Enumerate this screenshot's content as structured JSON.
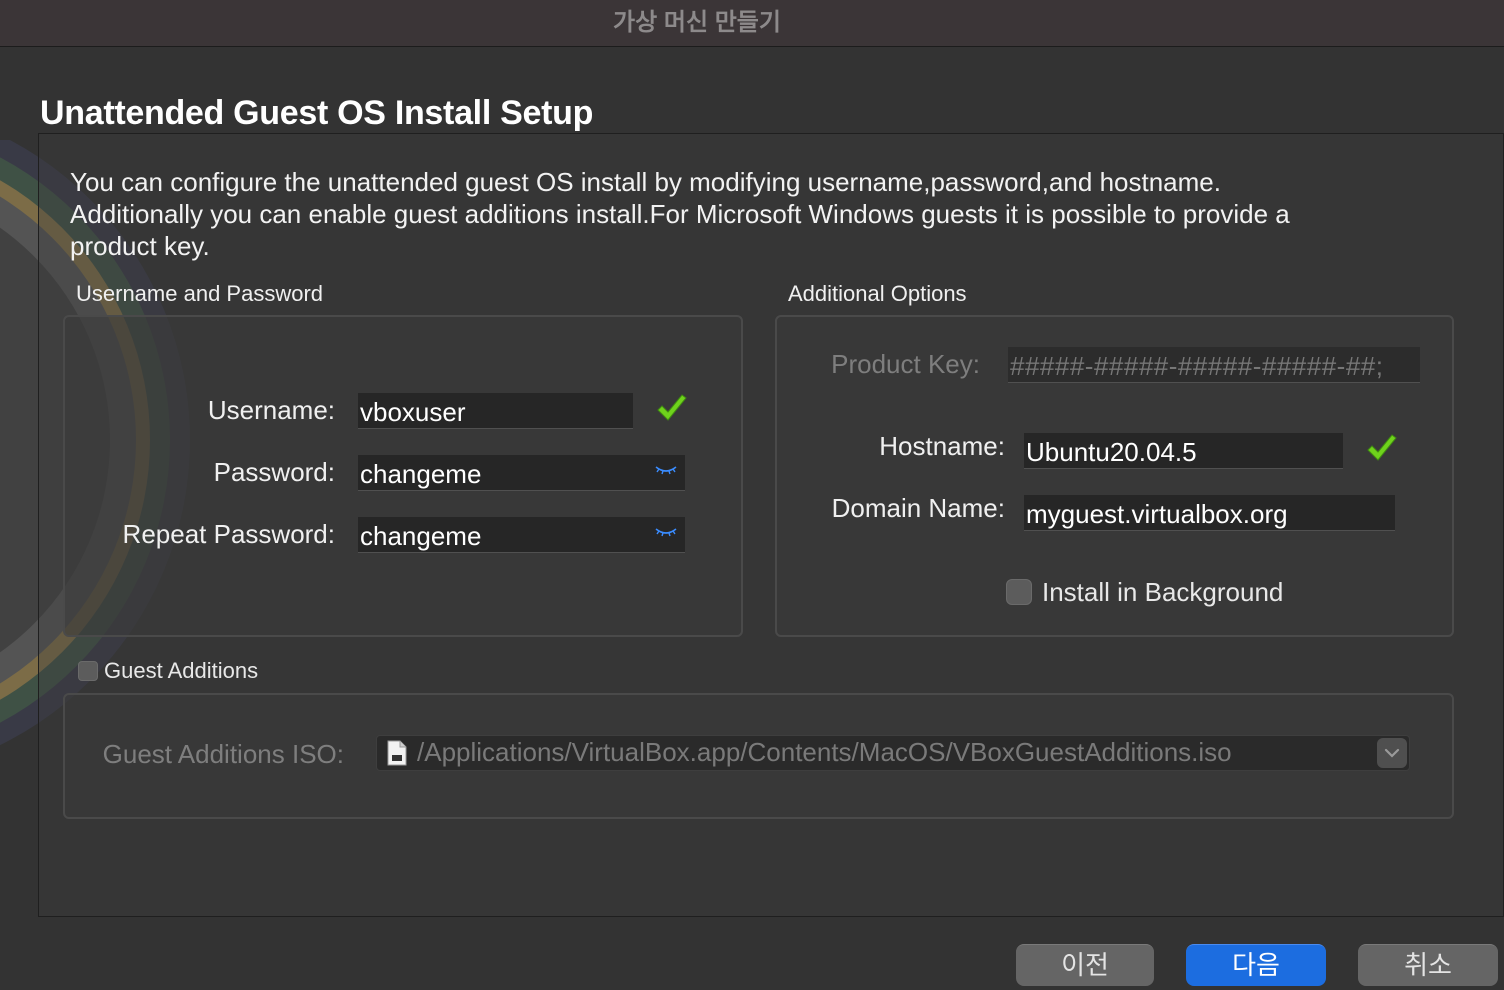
{
  "window": {
    "title": "가상 머신 만들기"
  },
  "page": {
    "heading": "Unattended Guest OS Install Setup",
    "description": "You can configure the unattended guest OS install by modifying username,password,and hostname. Additionally you can enable guest additions install.For Microsoft Windows guests it is possible to provide a product key."
  },
  "user_group": {
    "label": "Username and Password",
    "username_label": "Username:",
    "username_value": "vboxuser",
    "password_label": "Password:",
    "password_value": "changeme",
    "repeat_label": "Repeat Password:",
    "repeat_value": "changeme"
  },
  "options_group": {
    "label": "Additional Options",
    "product_key_label": "Product Key:",
    "product_key_placeholder": "#####-#####-#####-#####-##;",
    "hostname_label": "Hostname:",
    "hostname_value": "Ubuntu20.04.5",
    "domain_label": "Domain Name:",
    "domain_value": "myguest.virtualbox.org",
    "install_bg_label": "Install in Background",
    "install_bg_checked": false
  },
  "guest_additions": {
    "label": "Guest Additions",
    "checked": false,
    "iso_label": "Guest Additions ISO:",
    "iso_path": "/Applications/VirtualBox.app/Contents/MacOS/VBoxGuestAdditions.iso"
  },
  "buttons": {
    "back": "이전",
    "next": "다음",
    "cancel": "취소"
  },
  "colors": {
    "accent": "#1c6de0",
    "check": "#6fd21c",
    "background": "#333333"
  }
}
